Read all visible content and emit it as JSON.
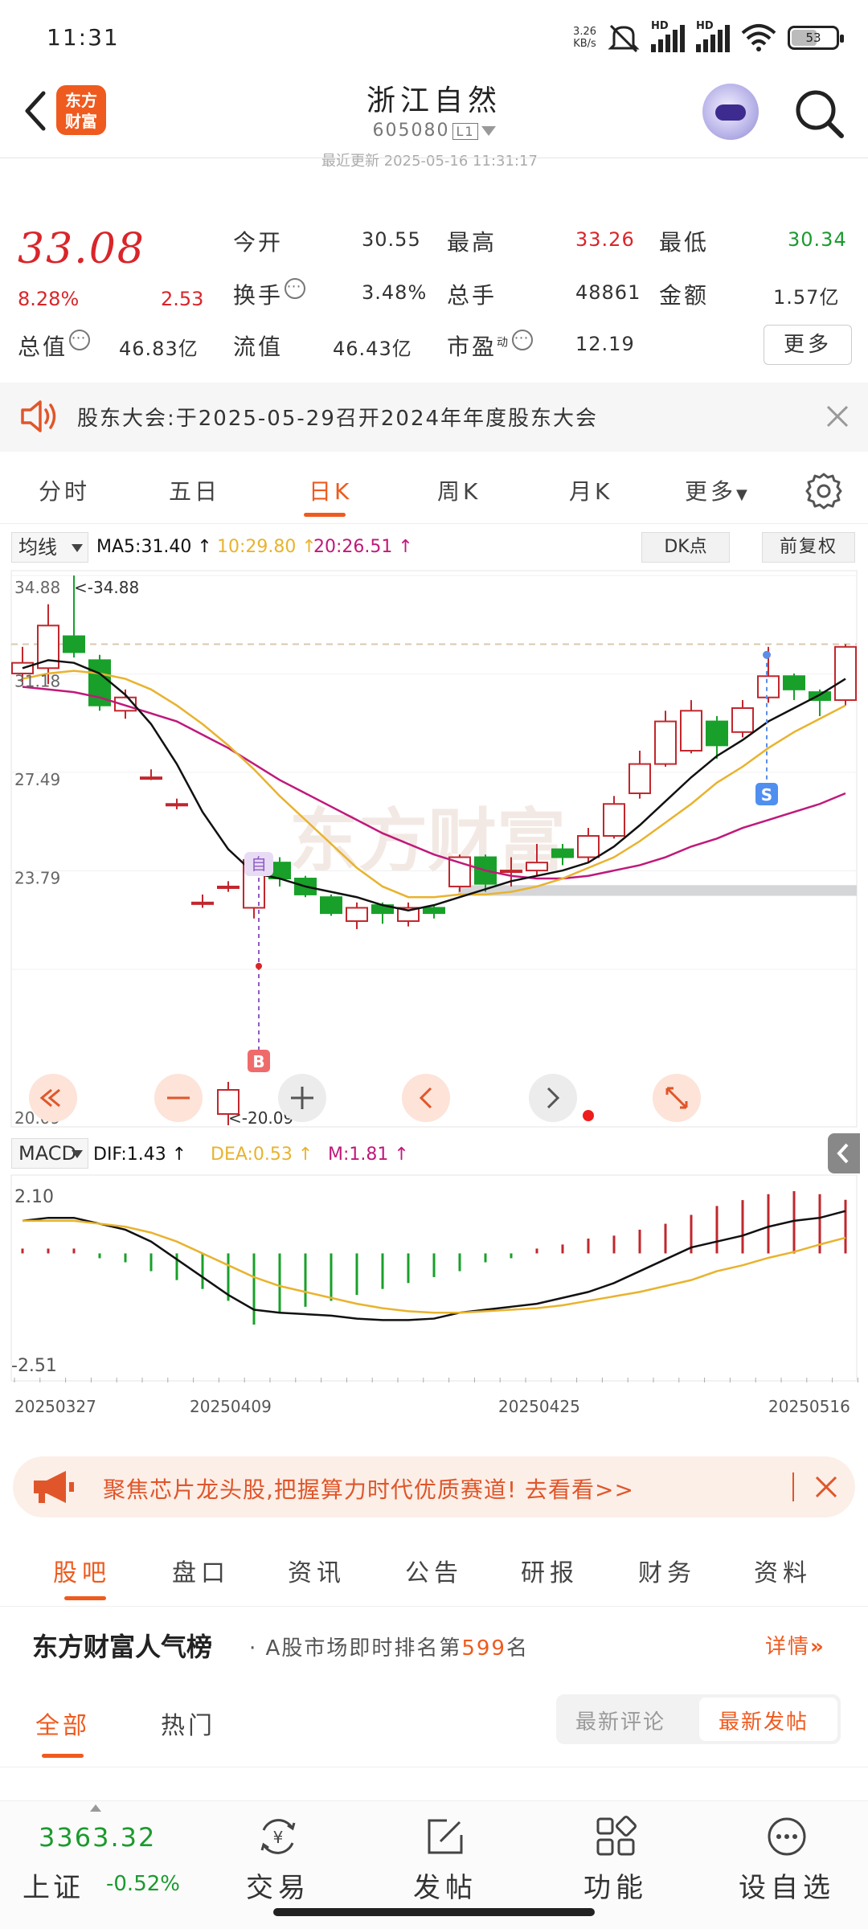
{
  "status_bar": {
    "time": "11:31",
    "net_speed_value": "3.26",
    "net_speed_unit": "KB/s",
    "signal_1": "HD",
    "signal_2": "HD",
    "battery": "53"
  },
  "header": {
    "title": "浙江自然",
    "code": "605080",
    "market_tag": "L1",
    "update_time": "最近更新 2025-05-16 11:31:17"
  },
  "quote": {
    "price": "33.08",
    "change_pct": "8.28%",
    "change": "2.53",
    "labels": {
      "open": "今开",
      "high": "最高",
      "low": "最低",
      "turnover": "换手",
      "volume": "总手",
      "amount": "金额",
      "market_cap": "总值",
      "float_cap": "流值",
      "pe": "市盈",
      "pe_sup": "动"
    },
    "values": {
      "open": "30.55",
      "high": "33.26",
      "low": "30.34",
      "turnover": "3.48%",
      "volume": "48861",
      "amount": "1.57亿",
      "market_cap": "46.83亿",
      "float_cap": "46.43亿",
      "pe": "12.19"
    },
    "more_label": "更多"
  },
  "notice": {
    "text": "股东大会:于2025-05-29召开2024年年度股东大会"
  },
  "chart_tabs": [
    "分时",
    "五日",
    "日K",
    "周K",
    "月K",
    "更多"
  ],
  "ma_bar": {
    "selector": "均线",
    "ma5": "MA5:31.40",
    "ma10": "10:29.80",
    "ma20": "20:26.51",
    "dk_label": "DK点",
    "adjust_label": "前复权"
  },
  "kchart": {
    "price_labels": [
      "34.88",
      "31.18",
      "27.49",
      "23.79",
      "20.09"
    ],
    "max_label": "<-34.88",
    "min_label": "<-20.09",
    "watermark": "东方财富",
    "signal_self": "自",
    "signal_buy": "B",
    "signal_sell": "S",
    "colors": {
      "up": "#c1272d",
      "down": "#18a02a",
      "ma5": "#111111",
      "ma10": "#e8b32e",
      "ma20": "#c0197a"
    }
  },
  "chart_data": [
    {
      "type": "candlestick",
      "title": "",
      "ylim": [
        20.09,
        34.88
      ],
      "y_ticks": [
        34.88,
        31.18,
        27.49,
        23.79,
        20.09
      ],
      "candles": [
        {
          "o": 31.2,
          "c": 31.6,
          "h": 32.2,
          "l": 30.9
        },
        {
          "o": 31.4,
          "c": 33.0,
          "h": 33.8,
          "l": 30.8
        },
        {
          "o": 32.6,
          "c": 32.0,
          "h": 34.88,
          "l": 31.8
        },
        {
          "o": 31.7,
          "c": 30.0,
          "h": 31.9,
          "l": 29.8
        },
        {
          "o": 29.8,
          "c": 30.3,
          "h": 30.6,
          "l": 29.5
        },
        {
          "o": 27.3,
          "c": 27.3,
          "h": 27.6,
          "l": 27.2
        },
        {
          "o": 26.3,
          "c": 26.3,
          "h": 26.5,
          "l": 26.1
        },
        {
          "o": 22.6,
          "c": 22.6,
          "h": 22.9,
          "l": 22.4
        },
        {
          "o": 23.2,
          "c": 23.2,
          "h": 23.4,
          "l": 23.0
        },
        {
          "o": 22.4,
          "c": 24.2,
          "h": 24.4,
          "l": 22.0
        },
        {
          "o": 24.1,
          "c": 23.5,
          "h": 24.3,
          "l": 23.2
        },
        {
          "o": 23.5,
          "c": 22.9,
          "h": 23.6,
          "l": 22.8
        },
        {
          "o": 22.8,
          "c": 22.2,
          "h": 22.9,
          "l": 22.1
        },
        {
          "o": 21.9,
          "c": 22.4,
          "h": 22.6,
          "l": 21.6
        },
        {
          "o": 22.5,
          "c": 22.2,
          "h": 22.6,
          "l": 21.8
        },
        {
          "o": 21.9,
          "c": 22.4,
          "h": 22.6,
          "l": 21.7
        },
        {
          "o": 22.4,
          "c": 22.2,
          "h": 22.5,
          "l": 22.0
        },
        {
          "o": 23.2,
          "c": 24.3,
          "h": 24.4,
          "l": 23.0
        },
        {
          "o": 24.3,
          "c": 23.3,
          "h": 24.4,
          "l": 23.0
        },
        {
          "o": 23.8,
          "c": 23.8,
          "h": 24.3,
          "l": 23.2
        },
        {
          "o": 23.8,
          "c": 24.1,
          "h": 24.8,
          "l": 23.6
        },
        {
          "o": 24.6,
          "c": 24.3,
          "h": 24.8,
          "l": 24.0
        },
        {
          "o": 24.3,
          "c": 25.1,
          "h": 25.4,
          "l": 24.1
        },
        {
          "o": 25.1,
          "c": 26.3,
          "h": 26.6,
          "l": 25.0
        },
        {
          "o": 26.7,
          "c": 27.8,
          "h": 28.3,
          "l": 26.5
        },
        {
          "o": 27.8,
          "c": 29.4,
          "h": 29.8,
          "l": 27.7
        },
        {
          "o": 28.3,
          "c": 29.8,
          "h": 30.2,
          "l": 28.2
        },
        {
          "o": 29.4,
          "c": 28.5,
          "h": 29.6,
          "l": 28.0
        },
        {
          "o": 29.0,
          "c": 29.9,
          "h": 30.2,
          "l": 28.8
        },
        {
          "o": 30.3,
          "c": 31.1,
          "h": 32.2,
          "l": 30.1
        },
        {
          "o": 31.1,
          "c": 30.6,
          "h": 31.2,
          "l": 30.2
        },
        {
          "o": 30.5,
          "c": 30.2,
          "h": 30.6,
          "l": 29.6
        },
        {
          "o": 30.2,
          "c": 32.2,
          "h": 32.3,
          "l": 30.0
        }
      ],
      "ma5": [
        31.4,
        31.7,
        31.6,
        31.2,
        30.4,
        29.3,
        27.8,
        26.0,
        24.6,
        23.7,
        23.5,
        23.2,
        23.0,
        22.8,
        22.5,
        22.3,
        22.5,
        22.8,
        23.1,
        23.4,
        23.6,
        23.8,
        24.1,
        24.7,
        25.5,
        26.4,
        27.3,
        28.1,
        28.7,
        29.4,
        29.9,
        30.4,
        31.0
      ],
      "ma10": [
        31.0,
        31.2,
        31.3,
        31.2,
        31.0,
        30.6,
        30.0,
        29.3,
        28.5,
        27.6,
        26.6,
        25.7,
        24.8,
        23.9,
        23.2,
        22.8,
        22.8,
        22.9,
        22.9,
        23.0,
        23.2,
        23.5,
        23.9,
        24.3,
        24.9,
        25.6,
        26.3,
        27.1,
        27.7,
        28.4,
        29.0,
        29.5,
        30.0
      ],
      "ma20": [
        30.7,
        30.6,
        30.5,
        30.3,
        30.0,
        29.7,
        29.4,
        28.9,
        28.4,
        27.8,
        27.2,
        26.7,
        26.2,
        25.7,
        25.2,
        24.8,
        24.4,
        24.1,
        23.8,
        23.6,
        23.5,
        23.5,
        23.6,
        23.8,
        24.0,
        24.3,
        24.7,
        25.0,
        25.4,
        25.7,
        26.0,
        26.3,
        26.7
      ]
    },
    {
      "type": "bar",
      "title": "",
      "ylim": [
        -2.51,
        2.1
      ],
      "y_ticks": [
        2.1,
        -2.51
      ],
      "categories": [
        "20250327",
        "20250409",
        "20250425",
        "20250516"
      ],
      "series": [
        {
          "name": "M",
          "values": [
            0.05,
            0.08,
            0.12,
            -0.15,
            -0.3,
            -0.6,
            -0.9,
            -1.2,
            -1.6,
            -2.4,
            -2.0,
            -1.8,
            -1.6,
            -1.4,
            -1.2,
            -1.0,
            -0.8,
            -0.6,
            -0.3,
            -0.05,
            0.1,
            0.3,
            0.5,
            0.6,
            0.8,
            1.0,
            1.3,
            1.6,
            1.8,
            2.0,
            2.1,
            2.0,
            1.81
          ]
        },
        {
          "name": "DIF",
          "values": [
            1.1,
            1.2,
            1.2,
            1.0,
            0.8,
            0.4,
            -0.2,
            -0.8,
            -1.4,
            -1.9,
            -2.0,
            -2.05,
            -2.1,
            -2.2,
            -2.25,
            -2.25,
            -2.2,
            -2.0,
            -1.9,
            -1.8,
            -1.7,
            -1.5,
            -1.3,
            -1.0,
            -0.6,
            -0.2,
            0.2,
            0.4,
            0.6,
            0.9,
            1.1,
            1.2,
            1.43
          ]
        },
        {
          "name": "DEA",
          "values": [
            1.1,
            1.1,
            1.1,
            1.0,
            0.9,
            0.7,
            0.4,
            0.0,
            -0.4,
            -0.8,
            -1.1,
            -1.3,
            -1.5,
            -1.7,
            -1.85,
            -1.95,
            -2.0,
            -2.0,
            -1.95,
            -1.9,
            -1.85,
            -1.75,
            -1.6,
            -1.45,
            -1.3,
            -1.1,
            -0.9,
            -0.6,
            -0.4,
            -0.15,
            0.05,
            0.3,
            0.53
          ]
        }
      ]
    }
  ],
  "macd_bar": {
    "selector": "MACD",
    "dif": "DIF:1.43",
    "dea": "DEA:0.53",
    "m": "M:1.81",
    "top_label": "2.10",
    "bottom_label": "-2.51",
    "dates": [
      "20250327",
      "20250409",
      "20250425",
      "20250516"
    ]
  },
  "promo": {
    "text": "聚焦芯片龙头股,把握算力时代优质赛道! 去看看>>"
  },
  "sub_tabs": [
    "股吧",
    "盘口",
    "资讯",
    "公告",
    "研报",
    "财务",
    "资料"
  ],
  "rank": {
    "brand": "东方财富人气榜",
    "desc_prefix": "· A股市场即时排名第",
    "rank_no": "599",
    "desc_suffix": "名",
    "detail": "详情"
  },
  "filter": {
    "tabs": [
      "全部",
      "热门"
    ],
    "seg_left": "最新评论",
    "seg_right": "最新发帖"
  },
  "bottom_nav": {
    "index_value": "3363.32",
    "index_name": "上证",
    "index_change": "-0.52%",
    "trade": "交易",
    "post": "发帖",
    "functions": "功能",
    "set_favorite": "设自选"
  }
}
